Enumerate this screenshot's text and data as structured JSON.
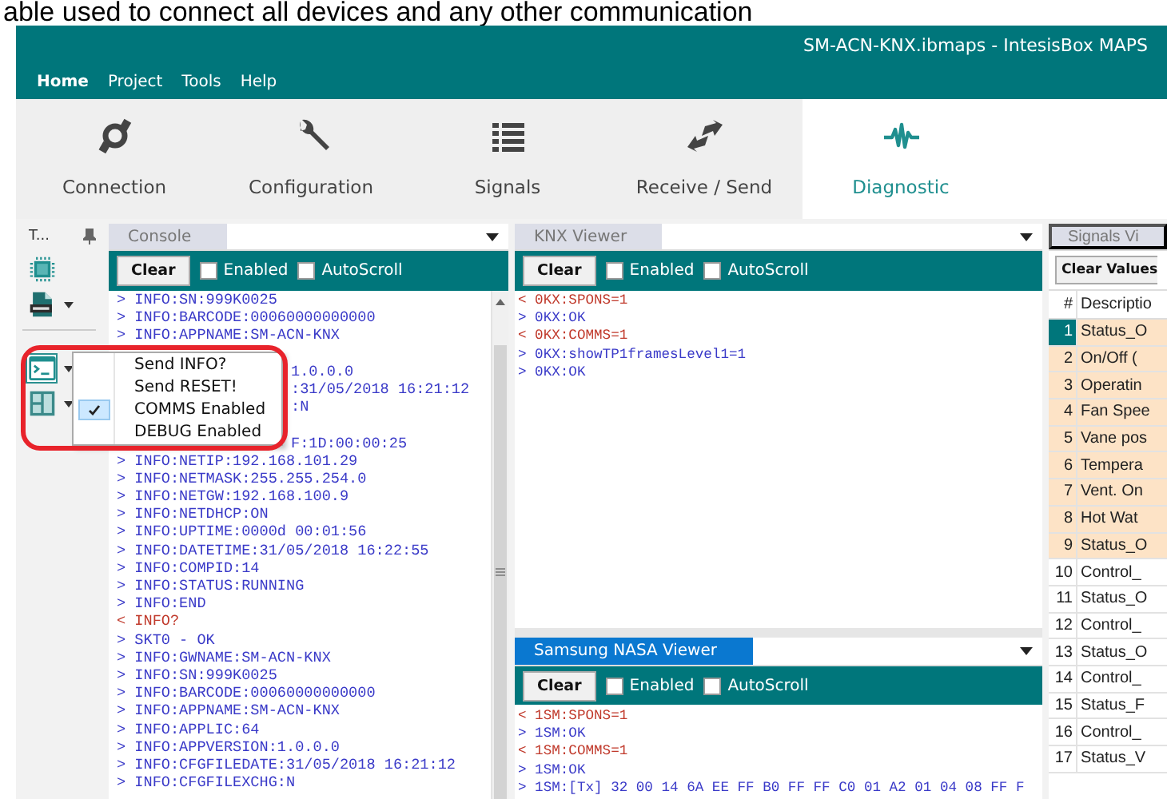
{
  "page_text": "able used to connect all devices and any other communication",
  "window": {
    "title": "SM-ACN-KNX.ibmaps - IntesisBox MAPS"
  },
  "menu": [
    {
      "label": "Home",
      "selected": true
    },
    {
      "label": "Project",
      "selected": false
    },
    {
      "label": "Tools",
      "selected": false
    },
    {
      "label": "Help",
      "selected": false
    }
  ],
  "ribbon": [
    {
      "label": "Connection",
      "kind": "connection",
      "selected": false
    },
    {
      "label": "Configuration",
      "kind": "configuration",
      "selected": false
    },
    {
      "label": "Signals",
      "kind": "signals",
      "selected": false
    },
    {
      "label": "Receive / Send",
      "kind": "transfer",
      "selected": false
    },
    {
      "label": "Diagnostic",
      "kind": "diagnostic",
      "selected": true
    }
  ],
  "toolbox": {
    "title": "T...",
    "items": [
      {
        "kind": "chip",
        "dropdown": false,
        "selected": false
      },
      {
        "kind": "log",
        "dropdown": true,
        "selected": false
      },
      {
        "kind": "terminal",
        "dropdown": true,
        "selected": true
      },
      {
        "kind": "layout",
        "dropdown": true,
        "selected": false
      }
    ]
  },
  "context_menu": {
    "items": [
      {
        "label": "Send INFO?",
        "checked": false
      },
      {
        "label": "Send RESET!",
        "checked": false
      },
      {
        "label": "COMMS Enabled",
        "checked": true
      },
      {
        "label": "DEBUG Enabled",
        "checked": false
      }
    ]
  },
  "console": {
    "tab": "Console",
    "clear": "Clear",
    "checkboxes": [
      {
        "label": "Enabled",
        "checked": false
      },
      {
        "label": "AutoScroll",
        "checked": false
      }
    ],
    "lines": [
      {
        "kind": "received",
        "text": "> INFO:SN:999K0025"
      },
      {
        "kind": "received",
        "text": "> INFO:BARCODE:00060000000000"
      },
      {
        "kind": "received",
        "text": "> INFO:APPNAME:SM-ACN-KNX"
      },
      {
        "kind": "hidden"
      },
      {
        "kind": "covered",
        "text": "1.0.0.0"
      },
      {
        "kind": "covered",
        "text": ":31/05/2018 16:21:12"
      },
      {
        "kind": "covered",
        "text": ":N"
      },
      {
        "kind": "hidden"
      },
      {
        "kind": "covered",
        "text": "F:1D:00:00:25"
      },
      {
        "kind": "received",
        "text": "> INFO:NETIP:192.168.101.29"
      },
      {
        "kind": "received",
        "text": "> INFO:NETMASK:255.255.254.0"
      },
      {
        "kind": "received",
        "text": "> INFO:NETGW:192.168.100.9"
      },
      {
        "kind": "received",
        "text": "> INFO:NETDHCP:ON"
      },
      {
        "kind": "received",
        "text": "> INFO:UPTIME:0000d 00:01:56"
      },
      {
        "kind": "received",
        "text": "> INFO:DATETIME:31/05/2018 16:22:55"
      },
      {
        "kind": "received",
        "text": "> INFO:COMPID:14"
      },
      {
        "kind": "received",
        "text": "> INFO:STATUS:RUNNING"
      },
      {
        "kind": "received",
        "text": "> INFO:END"
      },
      {
        "kind": "sent",
        "text": "< INFO?"
      },
      {
        "kind": "received",
        "text": "> SKT0 - OK"
      },
      {
        "kind": "received",
        "text": "> INFO:GWNAME:SM-ACN-KNX"
      },
      {
        "kind": "received",
        "text": "> INFO:SN:999K0025"
      },
      {
        "kind": "received",
        "text": "> INFO:BARCODE:00060000000000"
      },
      {
        "kind": "received",
        "text": "> INFO:APPNAME:SM-ACN-KNX"
      },
      {
        "kind": "received",
        "text": "> INFO:APPLIC:64"
      },
      {
        "kind": "received",
        "text": "> INFO:APPVERSION:1.0.0.0"
      },
      {
        "kind": "received",
        "text": "> INFO:CFGFILEDATE:31/05/2018 16:21:12"
      },
      {
        "kind": "received",
        "text": "> INFO:CFGFILEXCHG:N"
      }
    ]
  },
  "knx_viewer": {
    "tab": "KNX Viewer",
    "tab_selected": false,
    "clear": "Clear",
    "checkboxes": [
      {
        "label": "Enabled",
        "checked": false
      },
      {
        "label": "AutoScroll",
        "checked": false
      }
    ],
    "lines": [
      {
        "kind": "sent",
        "text": "< 0KX:SPONS=1"
      },
      {
        "kind": "received",
        "text": "> 0KX:OK"
      },
      {
        "kind": "sent",
        "text": "< 0KX:COMMS=1"
      },
      {
        "kind": "received",
        "text": "> 0KX:showTP1framesLevel1=1"
      },
      {
        "kind": "received",
        "text": "> 0KX:OK"
      }
    ]
  },
  "nasa_viewer": {
    "tab": "Samsung NASA Viewer",
    "tab_selected": true,
    "clear": "Clear",
    "checkboxes": [
      {
        "label": "Enabled",
        "checked": false
      },
      {
        "label": "AutoScroll",
        "checked": false
      }
    ],
    "lines": [
      {
        "kind": "sent",
        "text": "< 1SM:SPONS=1"
      },
      {
        "kind": "received",
        "text": "> 1SM:OK"
      },
      {
        "kind": "sent",
        "text": "< 1SM:COMMS=1"
      },
      {
        "kind": "received",
        "text": "> 1SM:OK"
      },
      {
        "kind": "received",
        "text": "> 1SM:[Tx] 32 00 14 6A EE FF B0 FF FF C0 01 A2 01 04 08 FF F"
      }
    ]
  },
  "signals": {
    "tab": "Signals Vi",
    "clear_values": "Clear Values",
    "columns": [
      "#",
      "Descriptio"
    ],
    "rows": [
      {
        "cells": [
          "1",
          "Status_O"
        ],
        "selected": true,
        "highlighted": true
      },
      {
        "cells": [
          "2",
          "On/Off ("
        ],
        "selected": false,
        "highlighted": true
      },
      {
        "cells": [
          "3",
          "Operatin"
        ],
        "selected": false,
        "highlighted": true
      },
      {
        "cells": [
          "4",
          "Fan Spee"
        ],
        "selected": false,
        "highlighted": true
      },
      {
        "cells": [
          "5",
          "Vane pos"
        ],
        "selected": false,
        "highlighted": true
      },
      {
        "cells": [
          "6",
          "Tempera"
        ],
        "selected": false,
        "highlighted": true
      },
      {
        "cells": [
          "7",
          "Vent. On"
        ],
        "selected": false,
        "highlighted": true
      },
      {
        "cells": [
          "8",
          "Hot Wat"
        ],
        "selected": false,
        "highlighted": true
      },
      {
        "cells": [
          "9",
          "Status_O"
        ],
        "selected": false,
        "highlighted": true
      },
      {
        "cells": [
          "10",
          "Control_"
        ],
        "selected": false,
        "highlighted": false
      },
      {
        "cells": [
          "11",
          "Status_O"
        ],
        "selected": false,
        "highlighted": false
      },
      {
        "cells": [
          "12",
          "Control_"
        ],
        "selected": false,
        "highlighted": false
      },
      {
        "cells": [
          "13",
          "Status_O"
        ],
        "selected": false,
        "highlighted": false
      },
      {
        "cells": [
          "14",
          "Control_"
        ],
        "selected": false,
        "highlighted": false
      },
      {
        "cells": [
          "15",
          "Status_F"
        ],
        "selected": false,
        "highlighted": false
      },
      {
        "cells": [
          "16",
          "Control_"
        ],
        "selected": false,
        "highlighted": false
      },
      {
        "cells": [
          "17",
          "Status_V"
        ],
        "selected": false,
        "highlighted": false
      }
    ]
  }
}
